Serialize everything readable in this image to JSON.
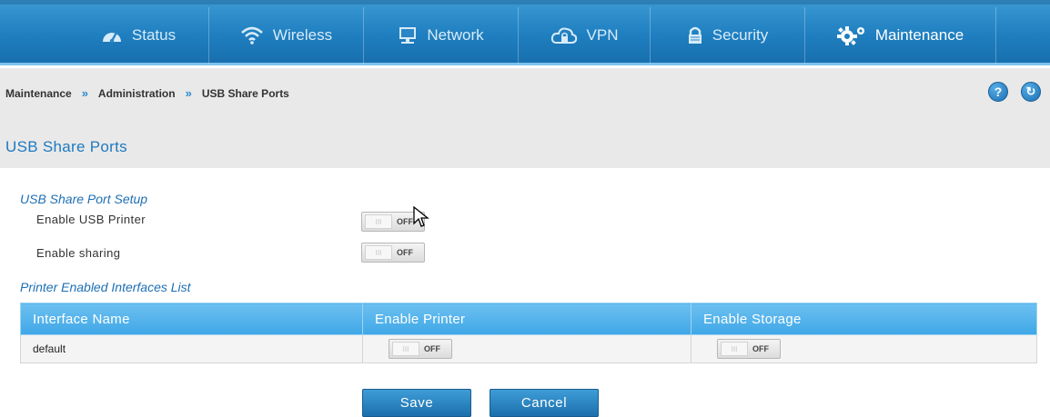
{
  "nav": {
    "tabs": [
      {
        "label": "Status",
        "icon": "gauge-icon"
      },
      {
        "label": "Wireless",
        "icon": "wifi-icon"
      },
      {
        "label": "Network",
        "icon": "monitor-icon"
      },
      {
        "label": "VPN",
        "icon": "cloud-lock-icon"
      },
      {
        "label": "Security",
        "icon": "lock-icon"
      },
      {
        "label": "Maintenance",
        "icon": "gears-icon",
        "active": true
      }
    ]
  },
  "breadcrumb": {
    "items": [
      "Maintenance",
      "Administration",
      "USB Share Ports"
    ],
    "separator": "»"
  },
  "header_buttons": {
    "help": "?",
    "refresh": "↻"
  },
  "page": {
    "title": "USB Share Ports"
  },
  "setup": {
    "heading": "USB Share Port Setup",
    "enable_printer_label": "Enable USB Printer",
    "enable_printer_state": "OFF",
    "enable_sharing_label": "Enable sharing",
    "enable_sharing_state": "OFF",
    "toggle_knob": "III"
  },
  "interfaces": {
    "heading": "Printer Enabled Interfaces List",
    "columns": [
      "Interface Name",
      "Enable Printer",
      "Enable Storage"
    ],
    "rows": [
      {
        "name": "default",
        "printer": "OFF",
        "storage": "OFF"
      }
    ]
  },
  "actions": {
    "save": "Save",
    "cancel": "Cancel"
  },
  "colors": {
    "accent": "#1e7ac0",
    "nav_bg": "#1f7fc0",
    "table_header": "#4aace9"
  }
}
